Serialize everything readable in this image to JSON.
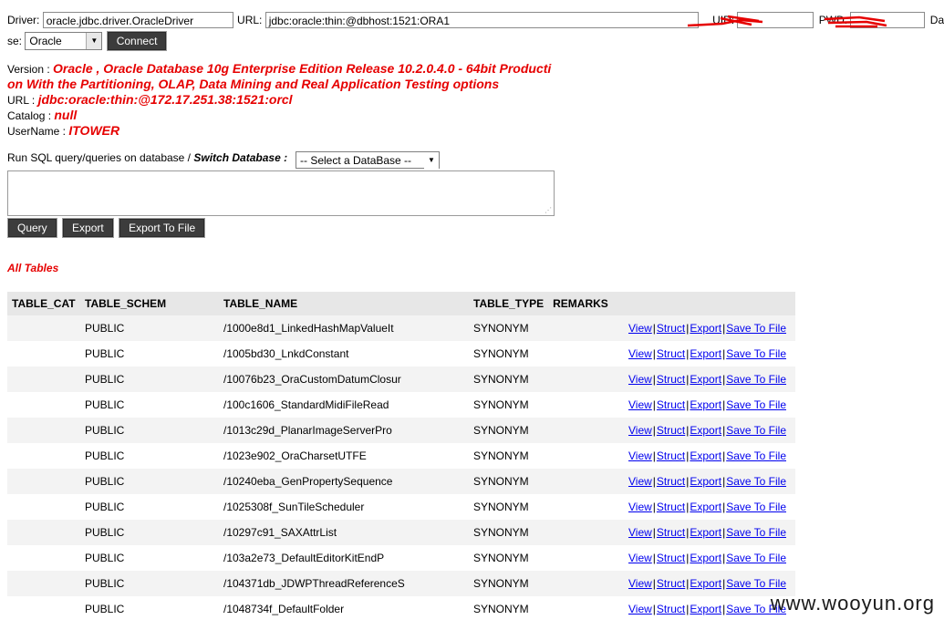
{
  "connection": {
    "driver_label": "Driver:",
    "driver_value": "oracle.jdbc.driver.OracleDriver",
    "url_label": "URL:",
    "url_value": "jdbc:oracle:thin:@dbhost:1521:ORA1",
    "uid_label": "UID:",
    "pwd_label": "PWD:",
    "database_label_part1": "DataBa",
    "database_label_part2": "se:",
    "database_selected": "Oracle",
    "connect_label": "Connect"
  },
  "info": {
    "version_label": "Version :",
    "version_value_line1": "Oracle , Oracle Database 10g Enterprise Edition Release 10.2.0.4.0 - 64bit Producti",
    "version_value_line2": "on With the Partitioning, OLAP, Data Mining and Real Application Testing options",
    "url_label": "URL :",
    "url_value": "jdbc:oracle:thin:@172.17.251.38:1521:orcl",
    "catalog_label": "Catalog :",
    "catalog_value": "null",
    "username_label": "UserName :",
    "username_value": "ITOWER"
  },
  "query": {
    "run_label": "Run SQL query/queries on database /",
    "switch_label": "Switch Database :",
    "db_select_value": "-- Select a DataBase --",
    "sql_value": "",
    "buttons": [
      "Query",
      "Export",
      "Export To File"
    ]
  },
  "all_tables_label": "All Tables",
  "table": {
    "columns": [
      "TABLE_CAT",
      "TABLE_SCHEM",
      "TABLE_NAME",
      "TABLE_TYPE",
      "REMARKS"
    ],
    "actions": [
      "View",
      "Struct",
      "Export",
      "Save To File"
    ],
    "rows": [
      {
        "cat": "",
        "schem": "PUBLIC",
        "name": "/1000e8d1_LinkedHashMapValueIt",
        "type": "SYNONYM",
        "remarks": ""
      },
      {
        "cat": "",
        "schem": "PUBLIC",
        "name": "/1005bd30_LnkdConstant",
        "type": "SYNONYM",
        "remarks": ""
      },
      {
        "cat": "",
        "schem": "PUBLIC",
        "name": "/10076b23_OraCustomDatumClosur",
        "type": "SYNONYM",
        "remarks": ""
      },
      {
        "cat": "",
        "schem": "PUBLIC",
        "name": "/100c1606_StandardMidiFileRead",
        "type": "SYNONYM",
        "remarks": ""
      },
      {
        "cat": "",
        "schem": "PUBLIC",
        "name": "/1013c29d_PlanarImageServerPro",
        "type": "SYNONYM",
        "remarks": ""
      },
      {
        "cat": "",
        "schem": "PUBLIC",
        "name": "/1023e902_OraCharsetUTFE",
        "type": "SYNONYM",
        "remarks": ""
      },
      {
        "cat": "",
        "schem": "PUBLIC",
        "name": "/10240eba_GenPropertySequence",
        "type": "SYNONYM",
        "remarks": ""
      },
      {
        "cat": "",
        "schem": "PUBLIC",
        "name": "/1025308f_SunTileScheduler",
        "type": "SYNONYM",
        "remarks": ""
      },
      {
        "cat": "",
        "schem": "PUBLIC",
        "name": "/10297c91_SAXAttrList",
        "type": "SYNONYM",
        "remarks": ""
      },
      {
        "cat": "",
        "schem": "PUBLIC",
        "name": "/103a2e73_DefaultEditorKitEndP",
        "type": "SYNONYM",
        "remarks": ""
      },
      {
        "cat": "",
        "schem": "PUBLIC",
        "name": "/104371db_JDWPThreadReferenceS",
        "type": "SYNONYM",
        "remarks": ""
      },
      {
        "cat": "",
        "schem": "PUBLIC",
        "name": "/1048734f_DefaultFolder",
        "type": "SYNONYM",
        "remarks": ""
      }
    ]
  },
  "watermark": "www.wooyun.org",
  "colors": {
    "accent_red": "#e60000",
    "link_blue": "#0000ee",
    "button_dark": "#3c3c3c",
    "header_gray": "#e7e7e7"
  }
}
